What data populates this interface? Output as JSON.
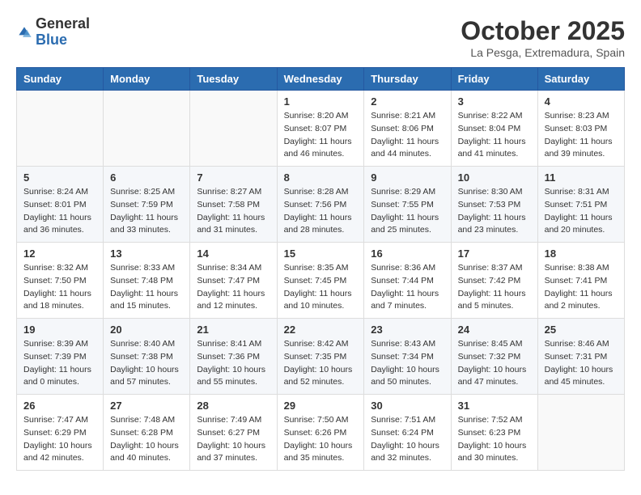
{
  "header": {
    "logo_general": "General",
    "logo_blue": "Blue",
    "month_title": "October 2025",
    "location": "La Pesga, Extremadura, Spain"
  },
  "weekdays": [
    "Sunday",
    "Monday",
    "Tuesday",
    "Wednesday",
    "Thursday",
    "Friday",
    "Saturday"
  ],
  "weeks": [
    [
      {
        "day": "",
        "sunrise": "",
        "sunset": "",
        "daylight": ""
      },
      {
        "day": "",
        "sunrise": "",
        "sunset": "",
        "daylight": ""
      },
      {
        "day": "",
        "sunrise": "",
        "sunset": "",
        "daylight": ""
      },
      {
        "day": "1",
        "sunrise": "Sunrise: 8:20 AM",
        "sunset": "Sunset: 8:07 PM",
        "daylight": "Daylight: 11 hours and 46 minutes."
      },
      {
        "day": "2",
        "sunrise": "Sunrise: 8:21 AM",
        "sunset": "Sunset: 8:06 PM",
        "daylight": "Daylight: 11 hours and 44 minutes."
      },
      {
        "day": "3",
        "sunrise": "Sunrise: 8:22 AM",
        "sunset": "Sunset: 8:04 PM",
        "daylight": "Daylight: 11 hours and 41 minutes."
      },
      {
        "day": "4",
        "sunrise": "Sunrise: 8:23 AM",
        "sunset": "Sunset: 8:03 PM",
        "daylight": "Daylight: 11 hours and 39 minutes."
      }
    ],
    [
      {
        "day": "5",
        "sunrise": "Sunrise: 8:24 AM",
        "sunset": "Sunset: 8:01 PM",
        "daylight": "Daylight: 11 hours and 36 minutes."
      },
      {
        "day": "6",
        "sunrise": "Sunrise: 8:25 AM",
        "sunset": "Sunset: 7:59 PM",
        "daylight": "Daylight: 11 hours and 33 minutes."
      },
      {
        "day": "7",
        "sunrise": "Sunrise: 8:27 AM",
        "sunset": "Sunset: 7:58 PM",
        "daylight": "Daylight: 11 hours and 31 minutes."
      },
      {
        "day": "8",
        "sunrise": "Sunrise: 8:28 AM",
        "sunset": "Sunset: 7:56 PM",
        "daylight": "Daylight: 11 hours and 28 minutes."
      },
      {
        "day": "9",
        "sunrise": "Sunrise: 8:29 AM",
        "sunset": "Sunset: 7:55 PM",
        "daylight": "Daylight: 11 hours and 25 minutes."
      },
      {
        "day": "10",
        "sunrise": "Sunrise: 8:30 AM",
        "sunset": "Sunset: 7:53 PM",
        "daylight": "Daylight: 11 hours and 23 minutes."
      },
      {
        "day": "11",
        "sunrise": "Sunrise: 8:31 AM",
        "sunset": "Sunset: 7:51 PM",
        "daylight": "Daylight: 11 hours and 20 minutes."
      }
    ],
    [
      {
        "day": "12",
        "sunrise": "Sunrise: 8:32 AM",
        "sunset": "Sunset: 7:50 PM",
        "daylight": "Daylight: 11 hours and 18 minutes."
      },
      {
        "day": "13",
        "sunrise": "Sunrise: 8:33 AM",
        "sunset": "Sunset: 7:48 PM",
        "daylight": "Daylight: 11 hours and 15 minutes."
      },
      {
        "day": "14",
        "sunrise": "Sunrise: 8:34 AM",
        "sunset": "Sunset: 7:47 PM",
        "daylight": "Daylight: 11 hours and 12 minutes."
      },
      {
        "day": "15",
        "sunrise": "Sunrise: 8:35 AM",
        "sunset": "Sunset: 7:45 PM",
        "daylight": "Daylight: 11 hours and 10 minutes."
      },
      {
        "day": "16",
        "sunrise": "Sunrise: 8:36 AM",
        "sunset": "Sunset: 7:44 PM",
        "daylight": "Daylight: 11 hours and 7 minutes."
      },
      {
        "day": "17",
        "sunrise": "Sunrise: 8:37 AM",
        "sunset": "Sunset: 7:42 PM",
        "daylight": "Daylight: 11 hours and 5 minutes."
      },
      {
        "day": "18",
        "sunrise": "Sunrise: 8:38 AM",
        "sunset": "Sunset: 7:41 PM",
        "daylight": "Daylight: 11 hours and 2 minutes."
      }
    ],
    [
      {
        "day": "19",
        "sunrise": "Sunrise: 8:39 AM",
        "sunset": "Sunset: 7:39 PM",
        "daylight": "Daylight: 11 hours and 0 minutes."
      },
      {
        "day": "20",
        "sunrise": "Sunrise: 8:40 AM",
        "sunset": "Sunset: 7:38 PM",
        "daylight": "Daylight: 10 hours and 57 minutes."
      },
      {
        "day": "21",
        "sunrise": "Sunrise: 8:41 AM",
        "sunset": "Sunset: 7:36 PM",
        "daylight": "Daylight: 10 hours and 55 minutes."
      },
      {
        "day": "22",
        "sunrise": "Sunrise: 8:42 AM",
        "sunset": "Sunset: 7:35 PM",
        "daylight": "Daylight: 10 hours and 52 minutes."
      },
      {
        "day": "23",
        "sunrise": "Sunrise: 8:43 AM",
        "sunset": "Sunset: 7:34 PM",
        "daylight": "Daylight: 10 hours and 50 minutes."
      },
      {
        "day": "24",
        "sunrise": "Sunrise: 8:45 AM",
        "sunset": "Sunset: 7:32 PM",
        "daylight": "Daylight: 10 hours and 47 minutes."
      },
      {
        "day": "25",
        "sunrise": "Sunrise: 8:46 AM",
        "sunset": "Sunset: 7:31 PM",
        "daylight": "Daylight: 10 hours and 45 minutes."
      }
    ],
    [
      {
        "day": "26",
        "sunrise": "Sunrise: 7:47 AM",
        "sunset": "Sunset: 6:29 PM",
        "daylight": "Daylight: 10 hours and 42 minutes."
      },
      {
        "day": "27",
        "sunrise": "Sunrise: 7:48 AM",
        "sunset": "Sunset: 6:28 PM",
        "daylight": "Daylight: 10 hours and 40 minutes."
      },
      {
        "day": "28",
        "sunrise": "Sunrise: 7:49 AM",
        "sunset": "Sunset: 6:27 PM",
        "daylight": "Daylight: 10 hours and 37 minutes."
      },
      {
        "day": "29",
        "sunrise": "Sunrise: 7:50 AM",
        "sunset": "Sunset: 6:26 PM",
        "daylight": "Daylight: 10 hours and 35 minutes."
      },
      {
        "day": "30",
        "sunrise": "Sunrise: 7:51 AM",
        "sunset": "Sunset: 6:24 PM",
        "daylight": "Daylight: 10 hours and 32 minutes."
      },
      {
        "day": "31",
        "sunrise": "Sunrise: 7:52 AM",
        "sunset": "Sunset: 6:23 PM",
        "daylight": "Daylight: 10 hours and 30 minutes."
      },
      {
        "day": "",
        "sunrise": "",
        "sunset": "",
        "daylight": ""
      }
    ]
  ]
}
